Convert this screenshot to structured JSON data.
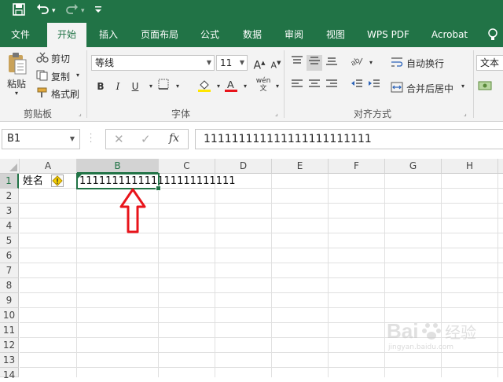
{
  "title_bar": {
    "save_icon": "save-icon",
    "undo_icon": "undo-icon",
    "redo_icon": "redo-icon",
    "customize_icon": "customize-qat-icon"
  },
  "tabs": [
    "文件",
    "开始",
    "插入",
    "页面布局",
    "公式",
    "数据",
    "审阅",
    "视图",
    "WPS PDF",
    "Acrobat"
  ],
  "active_tab": "开始",
  "ribbon": {
    "clipboard": {
      "paste": "粘贴",
      "cut": "剪切",
      "copy": "复制",
      "format_painter": "格式刷",
      "group_label": "剪贴板"
    },
    "font": {
      "font_name": "等线",
      "font_size": "11",
      "bold": "B",
      "italic": "I",
      "underline": "U",
      "grow": "A",
      "shrink": "A",
      "pinyin": "wén",
      "group_label": "字体"
    },
    "alignment": {
      "wrap_text": "自动换行",
      "merge_center": "合并后居中",
      "group_label": "对齐方式"
    },
    "number": {
      "format": "文本"
    }
  },
  "formula_bar": {
    "name_box": "B1",
    "fx": "fx",
    "content": "111111111111111111111111"
  },
  "columns": [
    "A",
    "B",
    "C",
    "D",
    "E",
    "F",
    "G",
    "H"
  ],
  "rows": [
    "1",
    "2",
    "3",
    "4",
    "5",
    "6",
    "7",
    "8",
    "9",
    "10",
    "11",
    "12",
    "13",
    "14"
  ],
  "cells": {
    "A1": "姓名",
    "B1": "111111111111111111111111"
  },
  "watermark": {
    "brand": "Bai",
    "brand2": "经验",
    "url": "jingyan.baidu.com"
  },
  "colors": {
    "accent": "#217346",
    "selection": "#217346",
    "arrow": "#e8141b"
  }
}
